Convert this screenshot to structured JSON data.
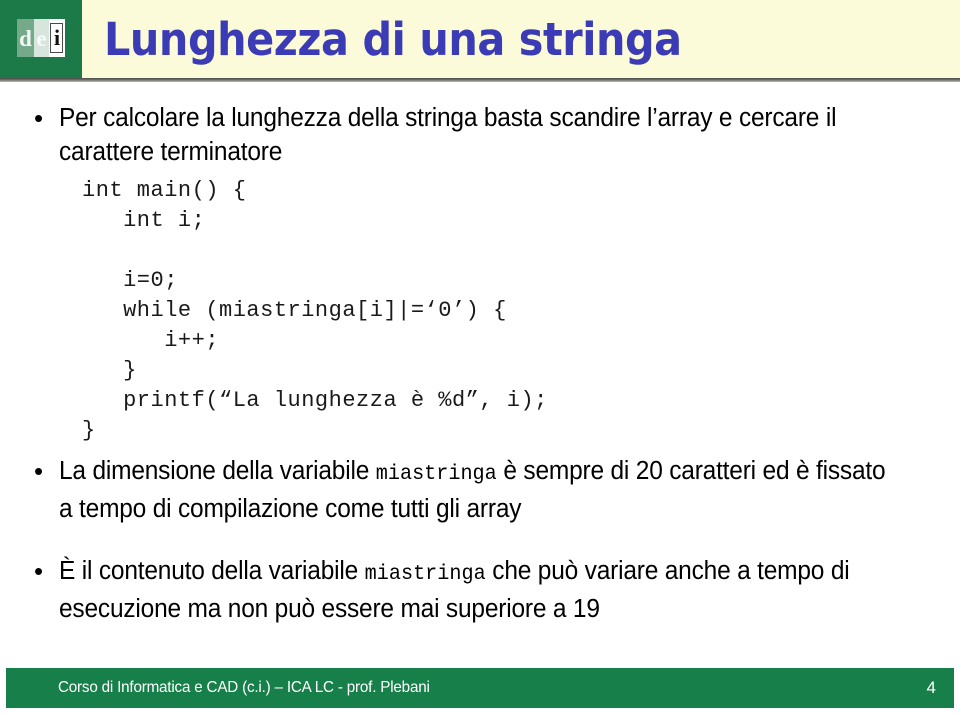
{
  "slide": {
    "title": "Lunghezza di una stringa",
    "logo": {
      "letter_d": "d",
      "letter_e": "e",
      "letter_i": "i"
    },
    "bullet_marker": "•",
    "bullets": [
      {
        "id": "bullet-1",
        "parts": [
          {
            "type": "text",
            "value": "Per calcolare la lunghezza della stringa basta scandire l’array e cercare il carattere terminatore"
          }
        ]
      },
      {
        "id": "bullet-2",
        "parts": [
          {
            "type": "text",
            "value": "La dimensione della variabile "
          },
          {
            "type": "mono",
            "value": "miastringa"
          },
          {
            "type": "text",
            "value": " è sempre di 20 caratteri ed è fissato a tempo di compilazione come tutti gli array"
          }
        ]
      },
      {
        "id": "bullet-3",
        "parts": [
          {
            "type": "text",
            "value": "È il contenuto della variabile "
          },
          {
            "type": "mono",
            "value": "miastringa"
          },
          {
            "type": "text",
            "value": " che può variare anche a tempo di esecuzione ma non può essere mai superiore a 19"
          }
        ]
      }
    ],
    "code_listing": {
      "language": "c",
      "lines": [
        "int main() {",
        "   int i;",
        "",
        "   i=0;",
        "   while (miastringa[i]|=‘0’) {",
        "      i++;",
        "   }",
        "   printf(“La lunghezza è %d”, i);",
        "}"
      ]
    },
    "footer": {
      "course_text": "Corso di Informatica e CAD (c.i.) – ICA LC - prof. Plebani",
      "page_number": "4"
    },
    "colors": {
      "header_band": "#fcfbd9",
      "logo_green": "#1b7a48",
      "title_blue": "#3b3bb5",
      "footer_green": "#17804a",
      "body_text": "#000000"
    }
  }
}
